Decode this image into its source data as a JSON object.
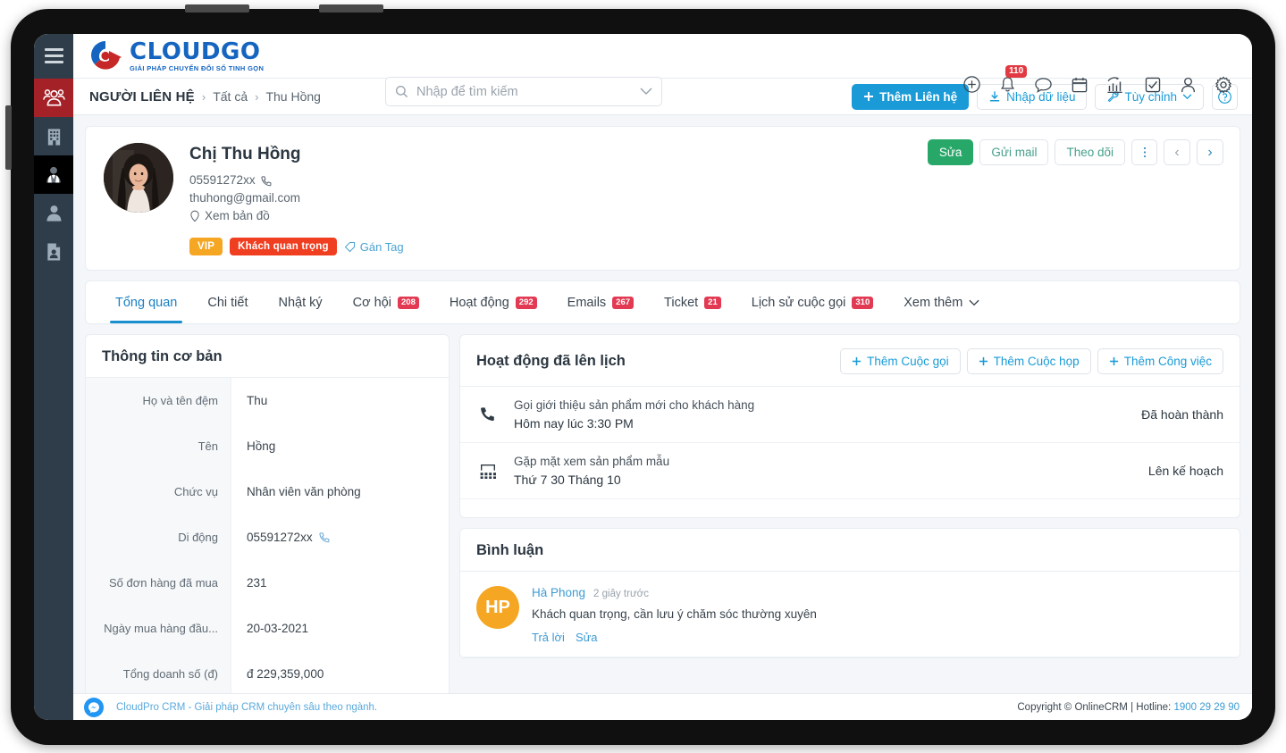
{
  "topbar": {
    "menu_icon": "hamburger-icon",
    "logo_name": "CLOUDGO",
    "logo_tagline": "GIẢI PHÁP CHUYỂN ĐỔI SỐ TINH GỌN",
    "search": {
      "placeholder": "Nhập để tìm kiếm",
      "value": ""
    },
    "icons": [
      {
        "name": "add-circle-icon"
      },
      {
        "name": "bell-icon",
        "badge": "110"
      },
      {
        "name": "chat-icon"
      },
      {
        "name": "calendar-icon"
      },
      {
        "name": "analytics-icon"
      },
      {
        "name": "checkbox-icon"
      },
      {
        "name": "user-icon"
      },
      {
        "name": "gear-icon"
      }
    ]
  },
  "sidebar": {
    "items": [
      {
        "name": "contacts",
        "icon": "people-group-icon",
        "state": "active-red"
      },
      {
        "name": "company",
        "icon": "building-icon",
        "state": "normal"
      },
      {
        "name": "leads",
        "icon": "user-tie-icon",
        "state": "active-dark"
      },
      {
        "name": "customer",
        "icon": "person-icon",
        "state": "normal"
      },
      {
        "name": "documents",
        "icon": "id-card-icon",
        "state": "normal"
      }
    ]
  },
  "breadcrumb": {
    "title": "NGƯỜI LIÊN HỆ",
    "sep": "›",
    "level2": "Tất cả",
    "level3": "Thu Hồng",
    "actions": {
      "add_contact": "Thêm Liên hệ",
      "import": "Nhập dữ liệu",
      "customize": "Tùy chỉnh",
      "help": "?"
    }
  },
  "profile": {
    "name": "Chị Thu Hồng",
    "phone": "05591272xx",
    "email": "thuhong@gmail.com",
    "map_link": "Xem bản đồ",
    "tags": [
      {
        "label": "VIP",
        "color": "#f5a623"
      },
      {
        "label": "Khách quan trọng",
        "color": "#f03e20"
      }
    ],
    "assign_tag": "Gán Tag",
    "actions": {
      "edit": "Sửa",
      "send_mail": "Gửi mail",
      "follow": "Theo dõi",
      "more": "⋮",
      "prev": "‹",
      "next": "›"
    }
  },
  "tabs": [
    {
      "label": "Tổng quan",
      "badge": null,
      "active": true
    },
    {
      "label": "Chi tiết",
      "badge": null,
      "active": false
    },
    {
      "label": "Nhật ký",
      "badge": null,
      "active": false
    },
    {
      "label": "Cơ hội",
      "badge": "208",
      "active": false
    },
    {
      "label": "Hoạt động",
      "badge": "292",
      "active": false
    },
    {
      "label": "Emails",
      "badge": "267",
      "active": false
    },
    {
      "label": "Ticket",
      "badge": "21",
      "active": false
    },
    {
      "label": "Lịch sử cuộc gọi",
      "badge": "310",
      "active": false
    },
    {
      "label": "Xem thêm",
      "badge": null,
      "active": false,
      "chevron": true
    }
  ],
  "basic_info": {
    "title": "Thông tin cơ bản",
    "fields": [
      {
        "label": "Họ và tên đệm",
        "value": "Thu",
        "icon": null
      },
      {
        "label": "Tên",
        "value": "Hồng",
        "icon": null
      },
      {
        "label": "Chức vụ",
        "value": "Nhân viên văn phòng",
        "icon": null
      },
      {
        "label": "Di động",
        "value": "05591272xx",
        "icon": "phone-icon"
      },
      {
        "label": "Số đơn hàng đã mua",
        "value": "231",
        "icon": null
      },
      {
        "label": "Ngày mua hàng đầu...",
        "value": "20-03-2021",
        "icon": null
      },
      {
        "label": "Tổng doanh số (đ)",
        "value": "đ 229,359,000",
        "icon": null
      }
    ]
  },
  "scheduled": {
    "title": "Hoạt động đã lên lịch",
    "buttons": [
      {
        "label": "Thêm Cuộc gọi"
      },
      {
        "label": "Thêm Cuộc họp"
      },
      {
        "label": "Thêm Công việc"
      }
    ],
    "rows": [
      {
        "icon": "phone-icon",
        "title": "Gọi giới thiệu sản phẩm mới cho khách hàng",
        "subtitle": "Hôm nay lúc 3:30 PM",
        "status": "Đã hoàn thành"
      },
      {
        "icon": "meeting-icon",
        "title": "Gặp mặt xem sản phẩm mẫu",
        "subtitle": "Thứ 7 30 Tháng 10",
        "status": "Lên kế hoạch"
      }
    ]
  },
  "comments": {
    "title": "Bình luận",
    "items": [
      {
        "initials": "HP",
        "author": "Hà Phong",
        "time": "2 giây trước",
        "text": "Khách quan trọng, cần lưu ý chăm sóc thường xuyên",
        "reply": "Trả lời",
        "edit": "Sửa"
      }
    ]
  },
  "footer": {
    "messenger_icon": "messenger-icon",
    "left": "CloudPro CRM - Giải pháp CRM chuyên sâu theo ngành.",
    "copyright": "Copyright © OnlineCRM | Hotline: ",
    "hotline": "1900 29 29 90"
  },
  "colors": {
    "primary_blue": "#1a9bd7",
    "tab_blue": "#1a8fd0",
    "green": "#28a868",
    "badge_red": "#e23a52",
    "sidebar": "#2e3d49",
    "sidebar_active": "#a52128"
  }
}
